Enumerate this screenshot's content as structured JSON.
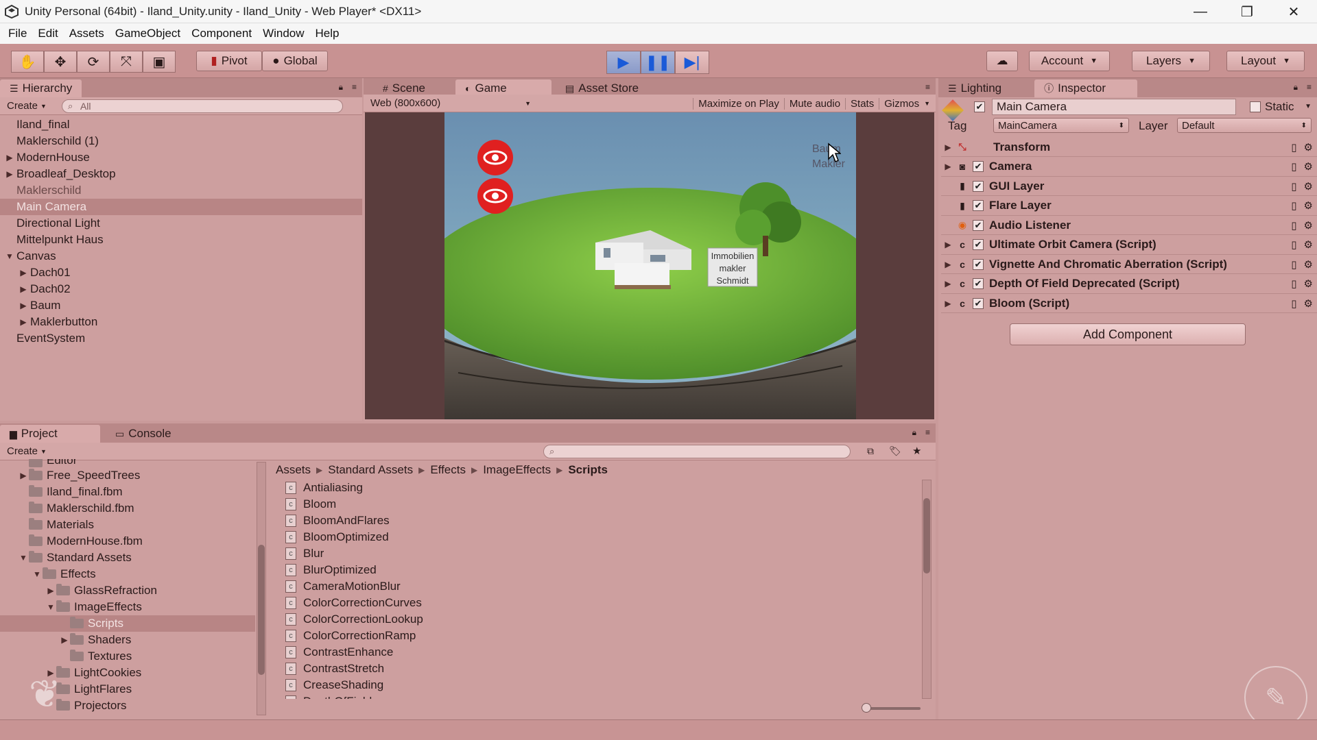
{
  "window": {
    "title": "Unity Personal (64bit) - Iland_Unity.unity - Iland_Unity - Web Player* <DX11>",
    "controls": [
      "—",
      "❐",
      "✕"
    ]
  },
  "menu": [
    "File",
    "Edit",
    "Assets",
    "GameObject",
    "Component",
    "Window",
    "Help"
  ],
  "toolbar": {
    "pivot_label": "Pivot",
    "global_label": "Global",
    "account_label": "Account",
    "layers_label": "Layers",
    "layout_label": "Layout"
  },
  "hierarchy": {
    "tab_label": "Hierarchy",
    "create_label": "Create",
    "search_placeholder": "All",
    "items": [
      {
        "label": "Iland_final",
        "indent": 0,
        "arrow": "",
        "state": ""
      },
      {
        "label": "Maklerschild (1)",
        "indent": 0,
        "arrow": "",
        "state": ""
      },
      {
        "label": "ModernHouse",
        "indent": 0,
        "arrow": "▶",
        "state": ""
      },
      {
        "label": "Broadleaf_Desktop",
        "indent": 0,
        "arrow": "▶",
        "state": ""
      },
      {
        "label": "Maklerschild",
        "indent": 0,
        "arrow": "",
        "state": "dim"
      },
      {
        "label": "Main Camera",
        "indent": 0,
        "arrow": "",
        "state": "selected"
      },
      {
        "label": "Directional Light",
        "indent": 0,
        "arrow": "",
        "state": ""
      },
      {
        "label": "Mittelpunkt Haus",
        "indent": 0,
        "arrow": "",
        "state": ""
      },
      {
        "label": "Canvas",
        "indent": 0,
        "arrow": "▼",
        "state": ""
      },
      {
        "label": "Dach01",
        "indent": 1,
        "arrow": "▶",
        "state": ""
      },
      {
        "label": "Dach02",
        "indent": 1,
        "arrow": "▶",
        "state": ""
      },
      {
        "label": "Baum",
        "indent": 1,
        "arrow": "▶",
        "state": ""
      },
      {
        "label": "Maklerbutton",
        "indent": 1,
        "arrow": "▶",
        "state": ""
      },
      {
        "label": "EventSystem",
        "indent": 0,
        "arrow": "",
        "state": ""
      }
    ]
  },
  "views": {
    "scene_tab": "Scene",
    "game_tab": "Game",
    "asset_store_tab": "Asset Store",
    "resolution": "Web (800x600)",
    "maximize_label": "Maximize on Play",
    "mute_label": "Mute audio",
    "stats_label": "Stats",
    "gizmos_label": "Gizmos",
    "sign_text": [
      "Immobilien",
      "makler",
      "Schmidt"
    ],
    "overlay_text": [
      "Baum",
      "Makler"
    ]
  },
  "inspector": {
    "lighting_tab": "Lighting",
    "inspector_tab": "Inspector",
    "object_name": "Main Camera",
    "static_label": "Static",
    "tag_label": "Tag",
    "tag_value": "MainCamera",
    "layer_label": "Layer",
    "layer_value": "Default",
    "components": [
      {
        "label": "Transform",
        "arrow": "▶",
        "checkbox": false,
        "icon": "transform-icon",
        "glyph": "⤡"
      },
      {
        "label": "Camera",
        "arrow": "▶",
        "checkbox": true,
        "icon": "camera-icon",
        "glyph": "◙"
      },
      {
        "label": "GUI Layer",
        "arrow": "",
        "checkbox": true,
        "icon": "gui-layer-icon",
        "glyph": "▮"
      },
      {
        "label": "Flare Layer",
        "arrow": "",
        "checkbox": true,
        "icon": "flare-layer-icon",
        "glyph": "▮"
      },
      {
        "label": "Audio Listener",
        "arrow": "",
        "checkbox": true,
        "icon": "audio-listener-icon",
        "glyph": "◉"
      },
      {
        "label": "Ultimate Orbit Camera (Script)",
        "arrow": "▶",
        "checkbox": true,
        "icon": "script-icon",
        "glyph": "c"
      },
      {
        "label": "Vignette And Chromatic Aberration (Script)",
        "arrow": "▶",
        "checkbox": true,
        "icon": "script-icon",
        "glyph": "c"
      },
      {
        "label": "Depth Of Field Deprecated (Script)",
        "arrow": "▶",
        "checkbox": true,
        "icon": "script-icon",
        "glyph": "c"
      },
      {
        "label": "Bloom (Script)",
        "arrow": "▶",
        "checkbox": true,
        "icon": "script-icon",
        "glyph": "c"
      }
    ],
    "add_component_label": "Add Component"
  },
  "project": {
    "project_tab": "Project",
    "console_tab": "Console",
    "create_label": "Create",
    "tree": [
      {
        "label": "Editor",
        "indent": 1,
        "arrow": "",
        "state": "cut"
      },
      {
        "label": "Free_SpeedTrees",
        "indent": 1,
        "arrow": "▶",
        "state": ""
      },
      {
        "label": "Iland_final.fbm",
        "indent": 1,
        "arrow": "",
        "state": ""
      },
      {
        "label": "Maklerschild.fbm",
        "indent": 1,
        "arrow": "",
        "state": ""
      },
      {
        "label": "Materials",
        "indent": 1,
        "arrow": "",
        "state": ""
      },
      {
        "label": "ModernHouse.fbm",
        "indent": 1,
        "arrow": "",
        "state": ""
      },
      {
        "label": "Standard Assets",
        "indent": 1,
        "arrow": "▼",
        "state": ""
      },
      {
        "label": "Effects",
        "indent": 2,
        "arrow": "▼",
        "state": ""
      },
      {
        "label": "GlassRefraction",
        "indent": 3,
        "arrow": "▶",
        "state": ""
      },
      {
        "label": "ImageEffects",
        "indent": 3,
        "arrow": "▼",
        "state": ""
      },
      {
        "label": "Scripts",
        "indent": 4,
        "arrow": "",
        "state": "selected"
      },
      {
        "label": "Shaders",
        "indent": 4,
        "arrow": "▶",
        "state": ""
      },
      {
        "label": "Textures",
        "indent": 4,
        "arrow": "",
        "state": ""
      },
      {
        "label": "LightCookies",
        "indent": 3,
        "arrow": "▶",
        "state": ""
      },
      {
        "label": "LightFlares",
        "indent": 3,
        "arrow": "",
        "state": ""
      },
      {
        "label": "Projectors",
        "indent": 3,
        "arrow": "",
        "state": ""
      }
    ],
    "breadcrumb": [
      "Assets",
      "Standard Assets",
      "Effects",
      "ImageEffects",
      "Scripts"
    ],
    "files": [
      "Antialiasing",
      "Bloom",
      "BloomAndFlares",
      "BloomOptimized",
      "Blur",
      "BlurOptimized",
      "CameraMotionBlur",
      "ColorCorrectionCurves",
      "ColorCorrectionLookup",
      "ColorCorrectionRamp",
      "ContrastEnhance",
      "ContrastStretch",
      "CreaseShading",
      "DepthOfField"
    ]
  }
}
